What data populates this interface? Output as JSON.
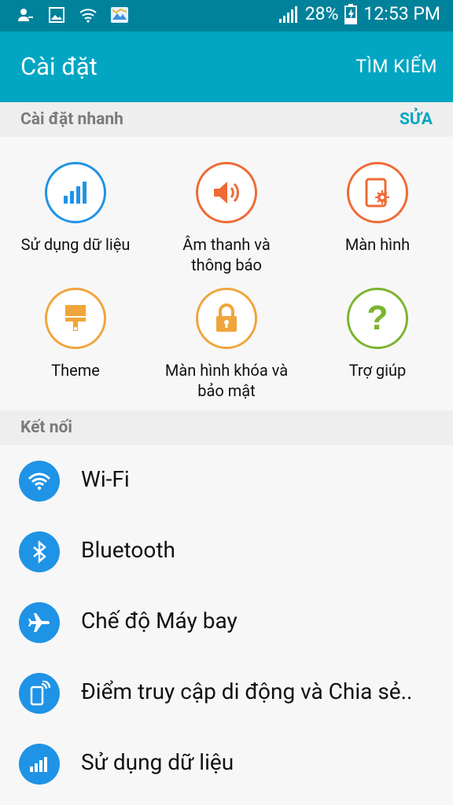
{
  "status_bar": {
    "battery": "28%",
    "time": "12:53 PM",
    "icons": [
      "person-icon",
      "image-icon",
      "wifi-status-icon",
      "map-icon",
      "signal-icon",
      "battery-charging-icon"
    ]
  },
  "app_bar": {
    "title": "Cài đặt",
    "search": "TÌM KIẾM"
  },
  "quick_settings": {
    "title": "Cài đặt nhanh",
    "edit": "SỬA",
    "tiles": [
      {
        "label": "Sử dụng dữ liệu",
        "icon": "data-usage-icon",
        "color": "#1f93e6"
      },
      {
        "label": "Âm thanh và thông báo",
        "icon": "sound-icon",
        "color": "#ef6a35"
      },
      {
        "label": "Màn hình",
        "icon": "display-icon",
        "color": "#ef6a35"
      },
      {
        "label": "Theme",
        "icon": "theme-brush-icon",
        "color": "#f0a53c"
      },
      {
        "label": "Màn hình khóa và bảo mật",
        "icon": "lock-icon",
        "color": "#f0a53c"
      },
      {
        "label": "Trợ giúp",
        "icon": "help-icon",
        "color": "#7cb32e"
      }
    ]
  },
  "connections": {
    "title": "Kết nối",
    "items": [
      {
        "label": "Wi-Fi",
        "icon": "wifi-icon"
      },
      {
        "label": "Bluetooth",
        "icon": "bluetooth-icon"
      },
      {
        "label": "Chế độ Máy bay",
        "icon": "airplane-icon"
      },
      {
        "label": "Điểm truy cập di động và Chia sẻ..",
        "icon": "hotspot-icon"
      },
      {
        "label": "Sử dụng dữ liệu",
        "icon": "data-usage-icon"
      }
    ]
  },
  "colors": {
    "status_bar": "#00829a",
    "app_bar": "#02a6c2",
    "accent": "#02a6c2",
    "list_icon": "#1f93e6"
  }
}
